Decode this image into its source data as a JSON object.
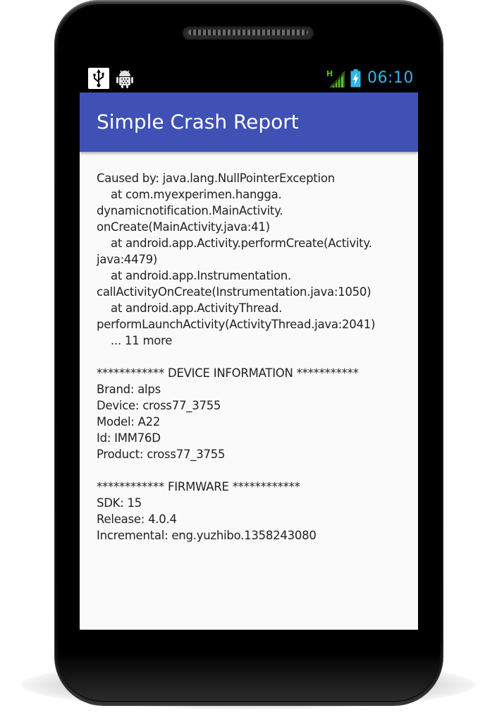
{
  "status_bar": {
    "time": "06:10",
    "network_type": "H",
    "left_icons": [
      "usb-icon",
      "android-debug-icon"
    ],
    "right_icons": [
      "signal-icon",
      "battery-charging-icon"
    ],
    "colors": {
      "clock": "#33b5e5",
      "signal": "#5dbb2a",
      "battery": "#33b5e5"
    }
  },
  "app_bar": {
    "title": "Simple Crash Report",
    "color": "#3f51b5"
  },
  "report": {
    "lines": [
      "Caused by: java.lang.NullPointerException",
      "    at com.myexperimen.hangga.",
      "dynamicnotification.MainActivity.",
      "onCreate(MainActivity.java:41)",
      "    at android.app.Activity.performCreate(Activity.",
      "java:4479)",
      "    at android.app.Instrumentation.",
      "callActivityOnCreate(Instrumentation.java:1050)",
      "    at android.app.ActivityThread.",
      "performLaunchActivity(ActivityThread.java:2041)",
      "    ... 11 more",
      "",
      "************ DEVICE INFORMATION ***********",
      "Brand: alps",
      "Device: cross77_3755",
      "Model: A22",
      "Id: IMM76D",
      "Product: cross77_3755",
      "",
      "************ FIRMWARE ************",
      "SDK: 15",
      "Release: 4.0.4",
      "Incremental: eng.yuzhibo.1358243080"
    ]
  }
}
